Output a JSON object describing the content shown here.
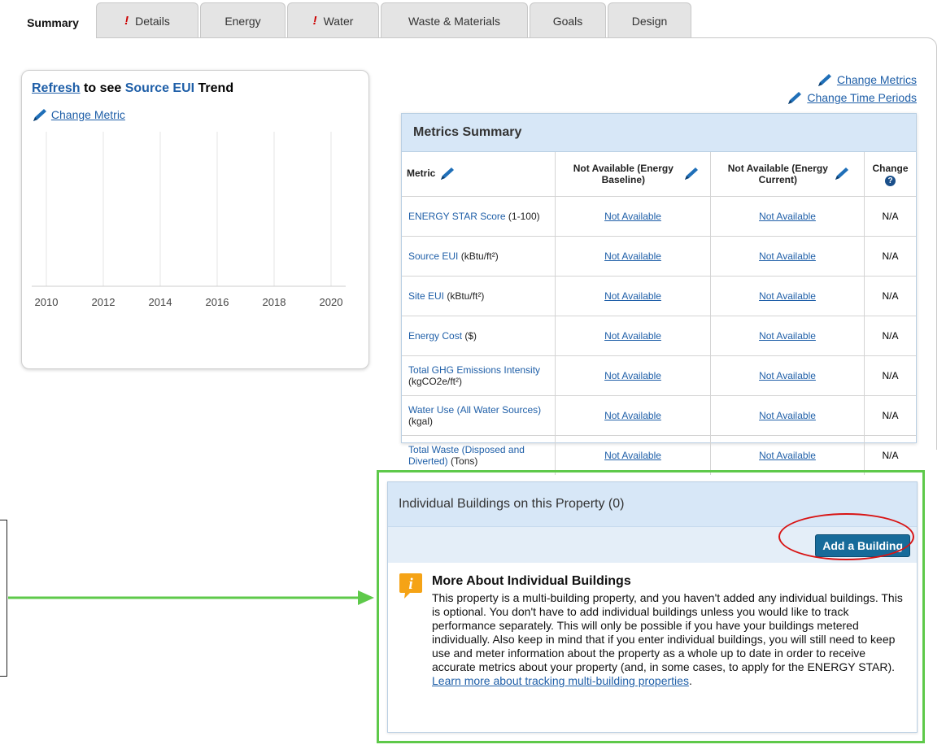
{
  "tabs": [
    {
      "label": "Summary",
      "warn": false,
      "active": true
    },
    {
      "label": "Details",
      "warn": true,
      "active": false
    },
    {
      "label": "Energy",
      "warn": false,
      "active": false
    },
    {
      "label": "Water",
      "warn": true,
      "active": false
    },
    {
      "label": "Waste & Materials",
      "warn": false,
      "active": false
    },
    {
      "label": "Goals",
      "warn": false,
      "active": false
    },
    {
      "label": "Design",
      "warn": false,
      "active": false
    }
  ],
  "warn_glyph": "!",
  "trend": {
    "refresh": "Refresh",
    "to_see": " to see ",
    "metric": "Source EUI",
    "trend_word": " Trend",
    "change_metric": "Change Metric",
    "years": [
      "2010",
      "2012",
      "2014",
      "2016",
      "2018",
      "2020"
    ]
  },
  "links": {
    "change_metrics": "Change Metrics",
    "change_time_periods": "Change Time Periods"
  },
  "metrics": {
    "title": "Metrics Summary",
    "col_metric": "Metric",
    "col_baseline": "Not Available (Energy Baseline)",
    "col_current": "Not Available (Energy Current)",
    "col_change": "Change",
    "help_glyph": "?",
    "rows": [
      {
        "name": "ENERGY STAR Score",
        "unit": " (1-100)",
        "baseline": "Not Available",
        "current": "Not Available",
        "change": "N/A"
      },
      {
        "name": "Source EUI",
        "unit": " (kBtu/ft²)",
        "baseline": "Not Available",
        "current": "Not Available",
        "change": "N/A"
      },
      {
        "name": "Site EUI",
        "unit": " (kBtu/ft²)",
        "baseline": "Not Available",
        "current": "Not Available",
        "change": "N/A"
      },
      {
        "name": "Energy Cost",
        "unit": " ($)",
        "baseline": "Not Available",
        "current": "Not Available",
        "change": "N/A"
      },
      {
        "name": "Total GHG Emissions Intensity",
        "unit": " (kgCO2e/ft²)",
        "baseline": "Not Available",
        "current": "Not Available",
        "change": "N/A"
      },
      {
        "name": "Water Use (All Water Sources)",
        "unit": " (kgal)",
        "baseline": "Not Available",
        "current": "Not Available",
        "change": "N/A"
      },
      {
        "name": "Total Waste (Disposed and Diverted)",
        "unit": " (Tons)",
        "baseline": "Not Available",
        "current": "Not Available",
        "change": "N/A"
      }
    ]
  },
  "buildings": {
    "title": "Individual Buildings on this Property (0)",
    "add_button": "Add a Building",
    "info_title": "More About Individual Buildings",
    "info_glyph": "i",
    "info_text": "This property is a multi-building property, and you haven't added any individual buildings. This is optional. You don't have to add individual buildings unless you would like to track performance separately. This will only be possible if you have your buildings metered individually. Also keep in mind that if you enter individual buildings, you will still need to keep use and meter information about the property as a whole up to date in order to receive accurate metrics about your property (and, in some cases, to apply for the ENERGY STAR). ",
    "learn_more": "Learn more about tracking multi-building properties",
    "period": "."
  },
  "colors": {
    "link": "#1f5fa8",
    "header_blue": "#d7e7f7",
    "button": "#176b9a",
    "highlight_green": "#5ec94a",
    "highlight_red": "#d81414",
    "info_orange": "#f5a316",
    "warn_red": "#cc0000"
  }
}
